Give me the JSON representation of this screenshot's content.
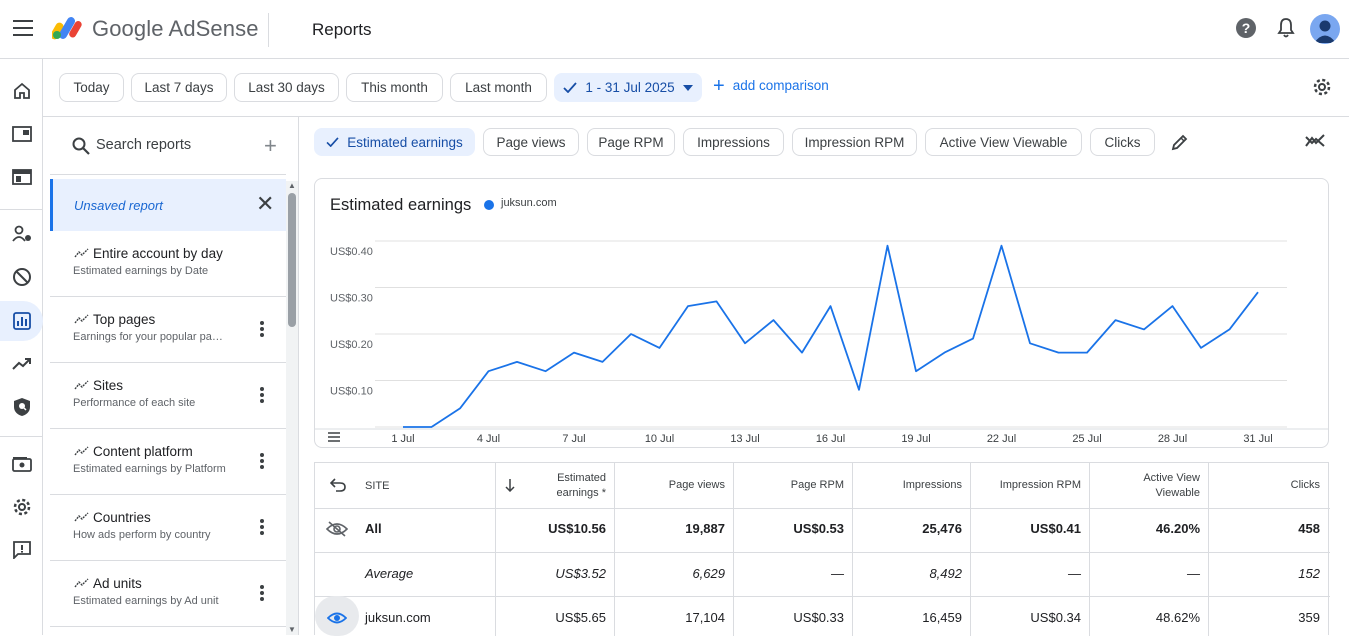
{
  "app": {
    "brand": "Google AdSense",
    "page_title": "Reports"
  },
  "date_chips": [
    "Today",
    "Last 7 days",
    "Last 30 days",
    "This month",
    "Last month"
  ],
  "date_range": "1 - 31 Jul 2025",
  "add_comparison": "add comparison",
  "search": {
    "placeholder": "Search reports"
  },
  "unsaved_report": "Unsaved report",
  "reports": [
    {
      "name": "Entire account by day",
      "desc": "Estimated earnings by Date"
    },
    {
      "name": "Top pages",
      "desc": "Earnings for your popular pages"
    },
    {
      "name": "Sites",
      "desc": "Performance of each site"
    },
    {
      "name": "Content platform",
      "desc": "Estimated earnings by Platform"
    },
    {
      "name": "Countries",
      "desc": "How ads perform by country"
    },
    {
      "name": "Ad units",
      "desc": "Estimated earnings by Ad unit"
    }
  ],
  "metrics": [
    "Estimated earnings",
    "Page views",
    "Page RPM",
    "Impressions",
    "Impression RPM",
    "Active View Viewable",
    "Clicks"
  ],
  "colors": {
    "accent": "#1a73e8",
    "selected_bg": "#e8f0fe",
    "line": "#1a73e8"
  },
  "chart_data": {
    "type": "line",
    "title": "Estimated earnings",
    "series": [
      {
        "name": "juksun.com",
        "x": [
          "1 Jul",
          "2 Jul",
          "3 Jul",
          "4 Jul",
          "5 Jul",
          "6 Jul",
          "7 Jul",
          "8 Jul",
          "9 Jul",
          "10 Jul",
          "11 Jul",
          "12 Jul",
          "13 Jul",
          "14 Jul",
          "15 Jul",
          "16 Jul",
          "17 Jul",
          "18 Jul",
          "19 Jul",
          "20 Jul",
          "21 Jul",
          "22 Jul",
          "23 Jul",
          "24 Jul",
          "25 Jul",
          "26 Jul",
          "27 Jul",
          "28 Jul",
          "29 Jul",
          "30 Jul",
          "31 Jul"
        ],
        "values": [
          0.0,
          0.0,
          0.04,
          0.12,
          0.14,
          0.12,
          0.16,
          0.14,
          0.2,
          0.17,
          0.26,
          0.27,
          0.18,
          0.23,
          0.16,
          0.26,
          0.08,
          0.39,
          0.12,
          0.16,
          0.19,
          0.39,
          0.18,
          0.16,
          0.16,
          0.23,
          0.21,
          0.26,
          0.17,
          0.21,
          0.29
        ]
      }
    ],
    "y_ticks": [
      "US$0.40",
      "US$0.30",
      "US$0.20",
      "US$0.10"
    ],
    "x_ticks": [
      "1 Jul",
      "4 Jul",
      "7 Jul",
      "10 Jul",
      "13 Jul",
      "16 Jul",
      "19 Jul",
      "22 Jul",
      "25 Jul",
      "28 Jul",
      "31 Jul"
    ],
    "ylim": [
      0,
      0.4
    ],
    "grid": true,
    "legend": "top-left"
  },
  "table": {
    "headers": [
      "SITE",
      "Estimated earnings *",
      "Page views",
      "Page RPM",
      "Impressions",
      "Impression RPM",
      "Active View Viewable",
      "Clicks"
    ],
    "rows": [
      {
        "site": "All",
        "vals": [
          "US$10.56",
          "19,887",
          "US$0.53",
          "25,476",
          "US$0.41",
          "46.20%",
          "458"
        ]
      },
      {
        "site": "Average",
        "vals": [
          "US$3.52",
          "6,629",
          "—",
          "8,492",
          "—",
          "—",
          "152"
        ]
      },
      {
        "site": "juksun.com",
        "vals": [
          "US$5.65",
          "17,104",
          "US$0.33",
          "16,459",
          "US$0.34",
          "48.62%",
          "359"
        ]
      }
    ]
  }
}
